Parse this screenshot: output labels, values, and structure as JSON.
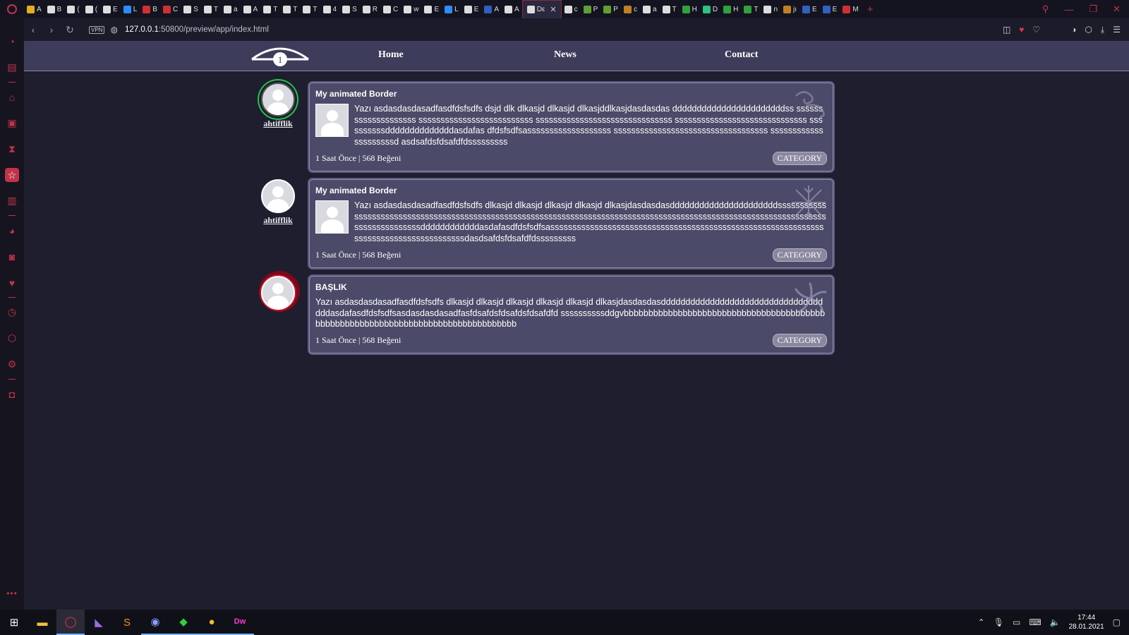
{
  "browser": {
    "tabs": [
      {
        "label": "A",
        "color": "#e0b020"
      },
      {
        "label": "B",
        "color": "#dddddd"
      },
      {
        "label": "(",
        "color": "#dddddd"
      },
      {
        "label": "(",
        "color": "#dddddd"
      },
      {
        "label": "E",
        "color": "#dddddd"
      },
      {
        "label": "L",
        "color": "#2d8cff"
      },
      {
        "label": "B",
        "color": "#d03030"
      },
      {
        "label": "C",
        "color": "#d03030"
      },
      {
        "label": "S",
        "color": "#dddddd"
      },
      {
        "label": "T",
        "color": "#dddddd"
      },
      {
        "label": "a",
        "color": "#dddddd"
      },
      {
        "label": "A",
        "color": "#dddddd"
      },
      {
        "label": "T",
        "color": "#dddddd"
      },
      {
        "label": "T",
        "color": "#dddddd"
      },
      {
        "label": "T",
        "color": "#dddddd"
      },
      {
        "label": "4",
        "color": "#dddddd"
      },
      {
        "label": "S",
        "color": "#dddddd"
      },
      {
        "label": "R",
        "color": "#dddddd"
      },
      {
        "label": "C",
        "color": "#dddddd"
      },
      {
        "label": "w",
        "color": "#dddddd"
      },
      {
        "label": "E",
        "color": "#dddddd"
      },
      {
        "label": "L",
        "color": "#2d8cff"
      },
      {
        "label": "E",
        "color": "#dddddd"
      },
      {
        "label": "A",
        "color": "#3060c0"
      },
      {
        "label": "A",
        "color": "#dddddd"
      },
      {
        "label": "Dε",
        "color": "#dddddd",
        "active": true
      },
      {
        "label": "c",
        "color": "#dddddd"
      },
      {
        "label": "P",
        "color": "#60a030"
      },
      {
        "label": "P",
        "color": "#60a030"
      },
      {
        "label": "c",
        "color": "#c08020"
      },
      {
        "label": "a",
        "color": "#dddddd"
      },
      {
        "label": "T",
        "color": "#dddddd"
      },
      {
        "label": "H",
        "color": "#30a040"
      },
      {
        "label": "D",
        "color": "#30c080"
      },
      {
        "label": "H",
        "color": "#30a040"
      },
      {
        "label": "T",
        "color": "#30a040"
      },
      {
        "label": "n",
        "color": "#dddddd"
      },
      {
        "label": "jı",
        "color": "#c08020"
      },
      {
        "label": "E",
        "color": "#3060c0"
      },
      {
        "label": "E",
        "color": "#3060c0"
      },
      {
        "label": "M",
        "color": "#d03030"
      }
    ],
    "url_host": "127.0.0.1",
    "url_rest": ":50800/preview/app/index.html",
    "vpn_label": "VPN",
    "sidebar_icons": [
      "speed-dial-icon",
      "bag-icon",
      "home-icon",
      "gamepad-icon",
      "hourglass-icon",
      "star-icon",
      "notes-icon",
      "messenger-icon",
      "instagram-icon",
      "twitter-icon",
      "history-icon",
      "cube-icon",
      "settings-icon",
      "vpn-icon"
    ],
    "accent_color": "#c0334a"
  },
  "site": {
    "nav": {
      "logo_number": "1",
      "links": [
        "Home",
        "News",
        "Contact"
      ]
    },
    "posts": [
      {
        "author": "ahtifflik",
        "avatar_style": "green",
        "title": "My animated Border",
        "has_thumb": true,
        "deco": "swirl",
        "text": "Yazı asdasdasdasadfasdfdsfsdfs dsjd dlk dlkasjd dlkasjd dlkasjddlkasjdasdasdas dddddddddddddddddddddddss ssssssssssssssssssss ssssssssssssssssssssssssss sssssssssssssssssssssssssssssss ssssssssssssssssssssssssssssss ssssssssssddddddddddddddasdafas dfdsfsdfsasssssssssssssssssss sssssssssssssssssssssssssssssssssss sssssssssssssssssssssd asdsafdsfdsafdfdsssssssss",
        "meta": "1 Saat Önce | 568 Beğeni",
        "category": "CATEGORY"
      },
      {
        "author": "ahtifflik",
        "avatar_style": "plain",
        "title": "My animated Border",
        "has_thumb": true,
        "deco": "snowflake",
        "text": "Yazı asdasdasdasadfasdfdsfsdfs dlkasjd dlkasjd dlkasjd dlkasjd dlkasjdasdasdasddddddddddddddddddddddsssssssssssssssssssssssssssssssssssssssssssssssssssssssssssssssssssssssssssssssssssssssssssssssssssssssssssssssssssssssssssssssssssssddddddddddddasdafasdfdsfsdfsasssssssssssssssssssssssssssssssssssssssssssssssssssssssssssssssssssssssssssssssssssssssdasdsafdsfdsafdfdsssssssss",
        "meta": "1 Saat Önce | 568 Beğeni",
        "category": "CATEGORY"
      },
      {
        "author": "",
        "avatar_style": "red",
        "title": "BAŞLIK",
        "has_thumb": false,
        "deco": "star",
        "text": "Yazı asdasdasdasadfasdfdsfsdfs dlkasjd dlkasjd dlkasjd dlkasjd dlkasjd dlkasjdasdasdasddddddddddddddddddddddddddddddddddddasdafasdfdsfsdfsasdasdasdasadfasfdsafdsfdsafdsfdsafdfd ssssssssssddgvbbbbbbbbbbbbbbbbbbbbbbbbbbbbbbbbbbbbbbbbbbbbbbbbbbbbbbbbbbbbbbbbbbbbbbbbbbbbbbbbbb",
        "meta": "1 Saat Önce | 568 Beğeni",
        "category": "CATEGORY"
      }
    ]
  },
  "taskbar": {
    "apps": [
      {
        "name": "file-explorer-icon",
        "glyph": "▬",
        "color": "#f0c040",
        "running": false
      },
      {
        "name": "opera-icon",
        "glyph": "◯",
        "color": "#e8334a",
        "running": true,
        "active": true
      },
      {
        "name": "visual-studio-icon",
        "glyph": "◣",
        "color": "#9a6ce0",
        "running": false
      },
      {
        "name": "sublime-text-icon",
        "glyph": "S",
        "color": "#f09020",
        "running": false
      },
      {
        "name": "discord-icon",
        "glyph": "◉",
        "color": "#8aa0ff",
        "running": true
      },
      {
        "name": "razer-icon",
        "glyph": "◆",
        "color": "#30d040",
        "running": true
      },
      {
        "name": "chrome-icon",
        "glyph": "●",
        "color": "#f0c030",
        "running": true
      },
      {
        "name": "dreamweaver-icon",
        "glyph": "Dw",
        "color": "#ff3ad0",
        "running": true
      }
    ],
    "time": "17:44",
    "date": "28.01.2021"
  }
}
